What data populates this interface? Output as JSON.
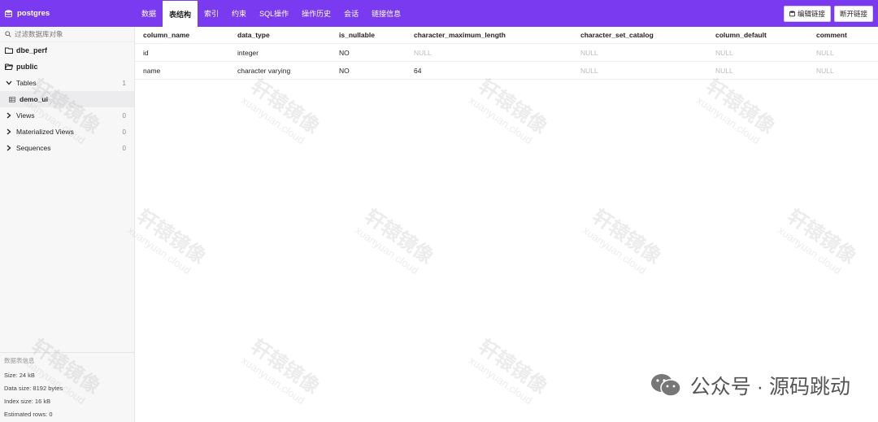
{
  "app": {
    "db_name": "postgres"
  },
  "tabs": [
    {
      "label": "数据",
      "active": false
    },
    {
      "label": "表结构",
      "active": true
    },
    {
      "label": "索引",
      "active": false
    },
    {
      "label": "约束",
      "active": false
    },
    {
      "label": "SQL操作",
      "active": false
    },
    {
      "label": "操作历史",
      "active": false
    },
    {
      "label": "会话",
      "active": false
    },
    {
      "label": "链接信息",
      "active": false
    }
  ],
  "actions": {
    "edit_label": "编辑链接",
    "disconnect_label": "断开链接"
  },
  "sidebar": {
    "search_placeholder": "过滤数据库对象",
    "schemas": [
      "dbe_perf",
      "public"
    ],
    "tables_label": "Tables",
    "tables_count": "1",
    "table_item": "demo_ui",
    "views_label": "Views",
    "views_count": "0",
    "mviews_label": "Materialized Views",
    "mviews_count": "0",
    "sequences_label": "Sequences",
    "sequences_count": "0"
  },
  "info": {
    "title": "数据表信息",
    "size": "Size: 24 kB",
    "data_size": "Data size: 8192 bytes",
    "index_size": "Index size: 16 kB",
    "estimated_rows": "Estimated rows: 0"
  },
  "table": {
    "columns": [
      "column_name",
      "data_type",
      "is_nullable",
      "character_maximum_length",
      "character_set_catalog",
      "column_default",
      "comment"
    ],
    "rows": [
      [
        "id",
        "integer",
        "NO",
        "NULL",
        "NULL",
        "NULL",
        "NULL"
      ],
      [
        "name",
        "character varying",
        "NO",
        "64",
        "NULL",
        "NULL",
        "NULL"
      ]
    ]
  },
  "watermark": {
    "cn": "轩辕镜像",
    "en": "xuanyuan.cloud"
  },
  "footer": {
    "wechat_text": "公众号 · 源码跳动"
  },
  "colors": {
    "accent": "#7a3bf0"
  }
}
